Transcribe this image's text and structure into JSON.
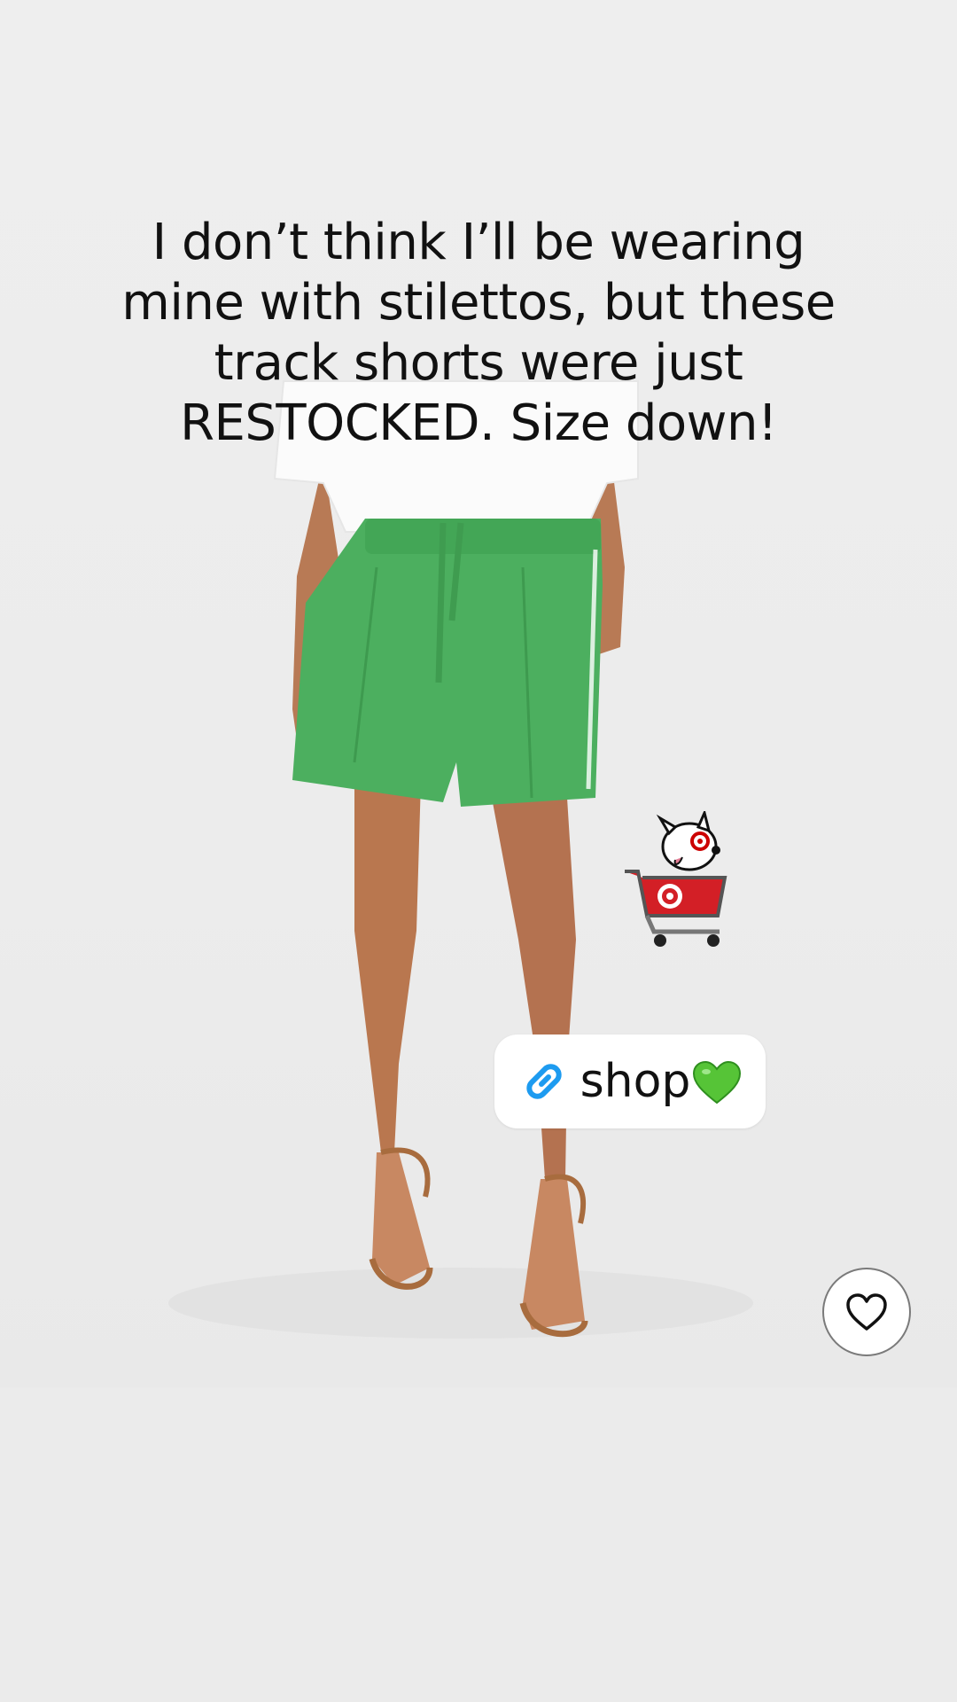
{
  "post": {
    "caption": "I don’t think I’ll be wearing mine with stilettos, but these track shorts were just RESTOCKED. Size down!"
  },
  "sticker": {
    "icon": "target-dog-cart-icon",
    "brand_color": "#cc0000"
  },
  "shop_link": {
    "label": "shop",
    "icon": "link-icon",
    "emoji": "green-heart-icon",
    "accent": "#1d9bf0"
  },
  "actions": {
    "like_icon": "heart-outline-icon"
  },
  "colors": {
    "shorts": "#4caf5f",
    "background": "#ededed"
  }
}
